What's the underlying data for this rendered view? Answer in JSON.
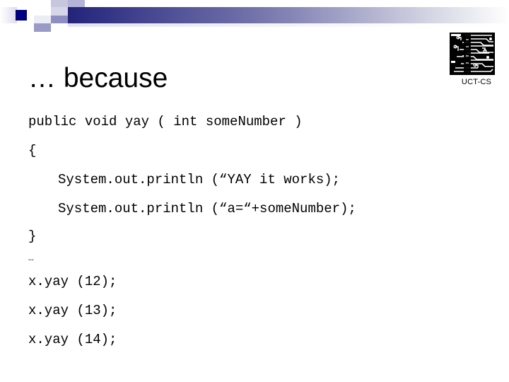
{
  "slide": {
    "title": "… because",
    "logo": {
      "caption": "UCT-CS",
      "icon": "circuit-board-logo"
    },
    "code_lines": [
      {
        "text": "public void yay ( int someNumber )",
        "indent": false
      },
      {
        "text": "{",
        "indent": false
      },
      {
        "text": "System.out.println (“YAY it works);",
        "indent": true
      },
      {
        "text": "System.out.println (“a=“+someNumber);",
        "indent": true
      },
      {
        "text": "}",
        "indent": false
      },
      {
        "text": "…",
        "indent": false
      },
      {
        "text": "x.yay (12);",
        "indent": false
      },
      {
        "text": "x.yay (13);",
        "indent": false
      },
      {
        "text": "x.yay (14);",
        "indent": false
      }
    ]
  },
  "colors": {
    "gradient_start": "#23237a",
    "gradient_end": "#ffffff",
    "deco_dark": "#000080",
    "deco_mid": "#9a9ac8",
    "deco_light": "#c6c6e0",
    "background": "#ffffff",
    "text": "#000000"
  }
}
